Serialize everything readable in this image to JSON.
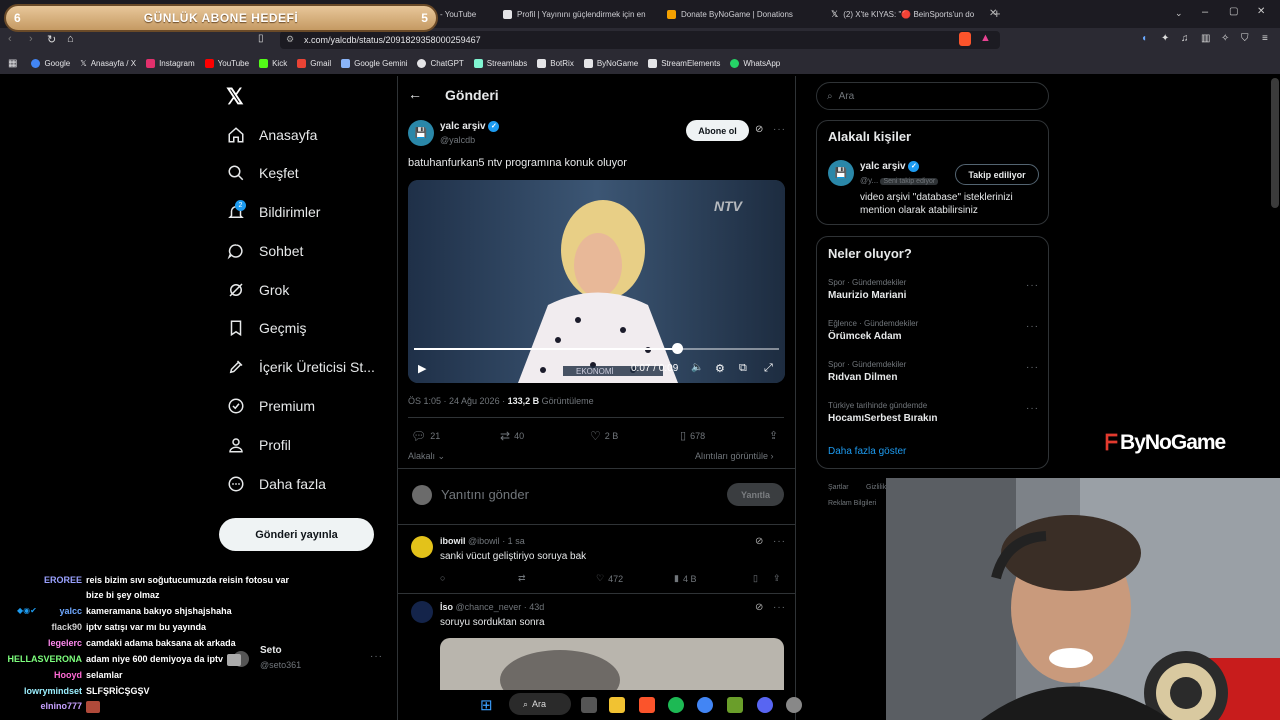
{
  "goal_overlay": {
    "left_num": "6",
    "title": "GÜNLÜK ABONE HEDEFİ",
    "right_num": "5"
  },
  "browser": {
    "tabs": [
      {
        "label": "- YouTube",
        "color": "#ff0000"
      },
      {
        "label": "Profil | Yayınını güçlendirmek için en",
        "color": "#e4e4e7"
      },
      {
        "label": "Donate ByNoGame | Donations",
        "color": "#f4a100"
      },
      {
        "label": "(2) X'te KIYAS: \"🔴 BeinSports'un do",
        "color": "#e4e4e7"
      }
    ],
    "url": "x.com/yalcdb/status/2091829358000259467",
    "bookmarks": [
      {
        "label": "Google",
        "color": "#4285f4"
      },
      {
        "label": "Anasayfa / X",
        "color": "#e4e4e7"
      },
      {
        "label": "Instagram",
        "color": "#e1306c"
      },
      {
        "label": "YouTube",
        "color": "#ff0000"
      },
      {
        "label": "Kick",
        "color": "#53fc18"
      },
      {
        "label": "Gmail",
        "color": "#ea4335"
      },
      {
        "label": "Google Gemini",
        "color": "#8ab4f8"
      },
      {
        "label": "ChatGPT",
        "color": "#e4e4e7"
      },
      {
        "label": "Streamlabs",
        "color": "#80f5d2"
      },
      {
        "label": "BotRix",
        "color": "#e4e4e7"
      },
      {
        "label": "ByNoGame",
        "color": "#e4e4e7"
      },
      {
        "label": "StreamElements",
        "color": "#e4e4e7"
      },
      {
        "label": "WhatsApp",
        "color": "#25d366"
      }
    ]
  },
  "nav": {
    "items": [
      {
        "label": "Anasayfa",
        "icon": "home-icon"
      },
      {
        "label": "Keşfet",
        "icon": "search-icon"
      },
      {
        "label": "Bildirimler",
        "icon": "bell-icon",
        "badge": "2"
      },
      {
        "label": "Sohbet",
        "icon": "chat-icon"
      },
      {
        "label": "Grok",
        "icon": "grok-icon"
      },
      {
        "label": "Geçmiş",
        "icon": "bookmark-icon"
      },
      {
        "label": "İçerik Üreticisi St...",
        "icon": "rocket-icon"
      },
      {
        "label": "Premium",
        "icon": "premium-icon"
      },
      {
        "label": "Profil",
        "icon": "profile-icon"
      },
      {
        "label": "Daha fazla",
        "icon": "more-circle-icon"
      }
    ],
    "post_button": "Gönderi yayınla"
  },
  "post": {
    "header": "Gönderi",
    "author_name": "yalc arşiv",
    "author_handle": "@yalcdb",
    "follow_label": "Abone ol",
    "text": "batuhanfurkan5 ntv programına konuk oluyor",
    "video": {
      "time": "0:07 / 0:09",
      "progress": 0.72,
      "channel": "NTV",
      "lower_third": "EKONOMİ"
    },
    "meta_time": "ÖS 1:05 · 24 Ağu 2026 · ",
    "views": "133,2 B",
    "views_label": " Görüntüleme",
    "stats": {
      "replies": "21",
      "reposts": "40",
      "likes": "2 B",
      "bookmarks": "678"
    },
    "relevance_label": "Alakalı",
    "quotes_label": "Alıntıları görüntüle",
    "reply_placeholder": "Yanıtını gönder",
    "reply_button": "Yanıtla"
  },
  "replies": [
    {
      "name": "ibowil",
      "handle": "@ibowil",
      "time": "· 1 sa",
      "text": "sanki vücut geliştiriyo soruya bak",
      "likes": "472",
      "views": "4 B"
    },
    {
      "name": "İso",
      "handle": "@chance_never",
      "time": "· 43d",
      "text": "soruyu sorduktan sonra"
    }
  ],
  "search": {
    "placeholder": "Ara"
  },
  "related": {
    "title": "Alakalı kişiler",
    "name": "yalc arşiv",
    "handle": "@y...",
    "follows_you": "Seni takip ediyor",
    "button": "Takip ediliyor",
    "bio": "video arşivi \"database\" isteklerinizi mention olarak atabilirsiniz"
  },
  "trends": {
    "title": "Neler oluyor?",
    "items": [
      {
        "category": "Spor · Gündemdekiler",
        "name": "Maurizio Mariani"
      },
      {
        "category": "Eğlence · Gündemdekiler",
        "name": "Örümcek Adam"
      },
      {
        "category": "Spor · Gündemdekiler",
        "name": "Rıdvan Dilmen"
      },
      {
        "category": "Türkiye tarihinde gündemde",
        "name": "HocamıSerbest Bırakın"
      }
    ],
    "more": "Daha fazla göster"
  },
  "footer_links": {
    "terms": "Şartlar",
    "privacy": "Gizlilik",
    "ads": "Reklam Bilgileri"
  },
  "brand_watermark": "ByNoGame",
  "chat": [
    {
      "user": "EROREE",
      "color": "#9aa2ff",
      "msg": "reis bizim sıvı soğutucumuzda reisin fotosu var"
    },
    {
      "user": "",
      "color": "#fff",
      "msg": "bize bi şey olmaz"
    },
    {
      "user": "yalcc",
      "color": "#6fa8ff",
      "msg": "kameramana bakıyo shjshajshaha"
    },
    {
      "user": "flack90",
      "color": "#d0d0d0",
      "msg": "iptv satışı var mı bu yayında"
    },
    {
      "user": "legelerc",
      "color": "#ff8af0",
      "msg": "camdaki adama baksana ak arkada"
    },
    {
      "user": "HELLASVERONA",
      "color": "#7dff7d",
      "msg": "adam niye 600 demiyoya da iptv"
    },
    {
      "user": "Hooyd",
      "color": "#ff6ad5",
      "msg": "selamlar"
    },
    {
      "user": "lowrymindset",
      "color": "#9cf0ff",
      "msg": "SLFŞRİCŞGŞV"
    },
    {
      "user": "elnino777",
      "color": "#c7a1ff",
      "msg": ""
    }
  ],
  "account_switcher": {
    "name": "Seto",
    "handle": "@seto361"
  },
  "taskbar": {
    "search_label": "Ara"
  }
}
